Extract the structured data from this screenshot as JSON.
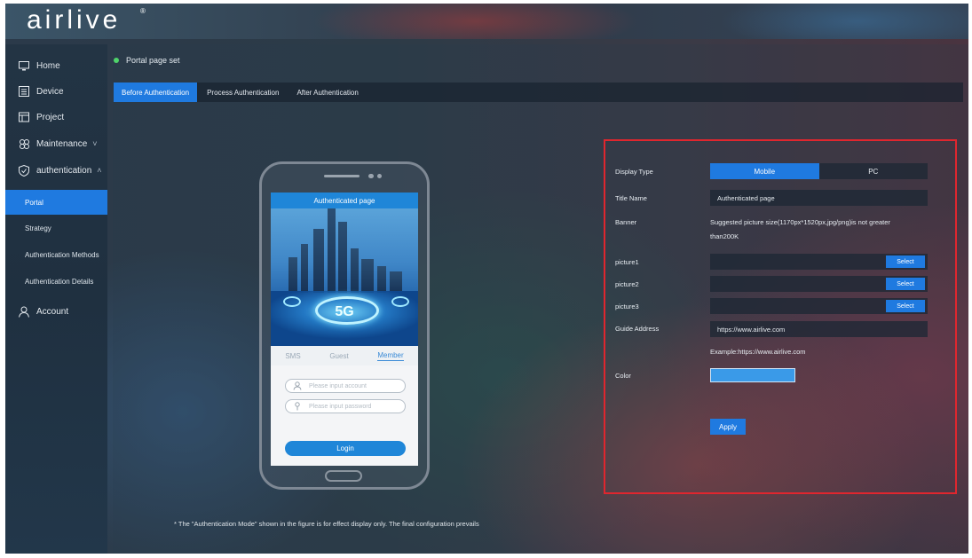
{
  "brand": {
    "logo_text": "airlive",
    "logo_mark": "®"
  },
  "sidebar": {
    "items": [
      {
        "label": "Home",
        "icon": "monitor-icon"
      },
      {
        "label": "Device",
        "icon": "device-list-icon"
      },
      {
        "label": "Project",
        "icon": "project-icon"
      },
      {
        "label": "Maintenance",
        "icon": "maintenance-icon",
        "chevron": "˅"
      },
      {
        "label": "authentication",
        "icon": "shield-check-icon",
        "chevron": "˄"
      }
    ],
    "sub_items": [
      {
        "label": "Portal",
        "active": true
      },
      {
        "label": "Strategy"
      },
      {
        "label": "Authentication Methods"
      },
      {
        "label": "Authentication Details"
      }
    ],
    "account": {
      "label": "Account",
      "icon": "user-icon"
    }
  },
  "page": {
    "breadcrumb": "Portal page set",
    "tabs": [
      {
        "label": "Before Authentication",
        "active": true
      },
      {
        "label": "Process Authentication"
      },
      {
        "label": "After Authentication"
      }
    ]
  },
  "preview": {
    "title": "Authenticated page",
    "banner_text": "5G",
    "tabs": [
      "SMS",
      "Guest",
      "Member"
    ],
    "account_placeholder": "Please input account",
    "password_placeholder": "Please input password",
    "login_label": "Login"
  },
  "footnote": "* The \"Authentication Mode\" shown in the figure is for effect display only. The final configuration prevails",
  "settings": {
    "display_type_label": "Display Type",
    "display_options": [
      "Mobile",
      "PC"
    ],
    "title_name_label": "Title Name",
    "title_name_value": "Authenticated page",
    "banner_label": "Banner",
    "banner_hint_line1": "Suggested picture size(1170px*1520px,jpg/png)is not greater",
    "banner_hint_line2": "than200K",
    "picture1_label": "picture1",
    "picture2_label": "picture2",
    "picture3_label": "picture3",
    "select_label": "Select",
    "guide_address_label": "Guide Address",
    "guide_address_value": "https://www.airlive.com",
    "guide_example": "Example:https://www.airlive.com",
    "color_label": "Color",
    "color_value": "#3a9ae8",
    "apply_label": "Apply"
  },
  "colors": {
    "accent": "#1f7ae0",
    "highlight_border": "#e0262e",
    "status_dot": "#4fd36a"
  }
}
